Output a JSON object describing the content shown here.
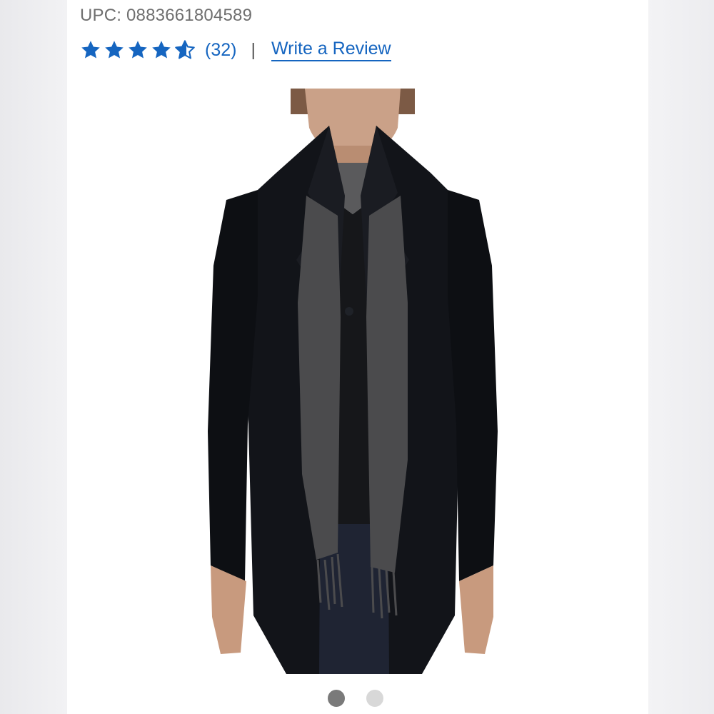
{
  "product": {
    "upc": "UPC: 0883661804589",
    "rating": {
      "value": 4.5,
      "max": 5,
      "count_label": "(32)",
      "separator": "|"
    },
    "review_link": "Write a Review",
    "image": {
      "description": "Man wearing black wool coat with gray fringed scarf"
    }
  },
  "carousel": {
    "total": 2,
    "active_index": 0
  },
  "colors": {
    "link": "#1565c0",
    "text_muted": "#6e6e6e",
    "coat": "#111318",
    "scarf": "#4b4b4d"
  }
}
